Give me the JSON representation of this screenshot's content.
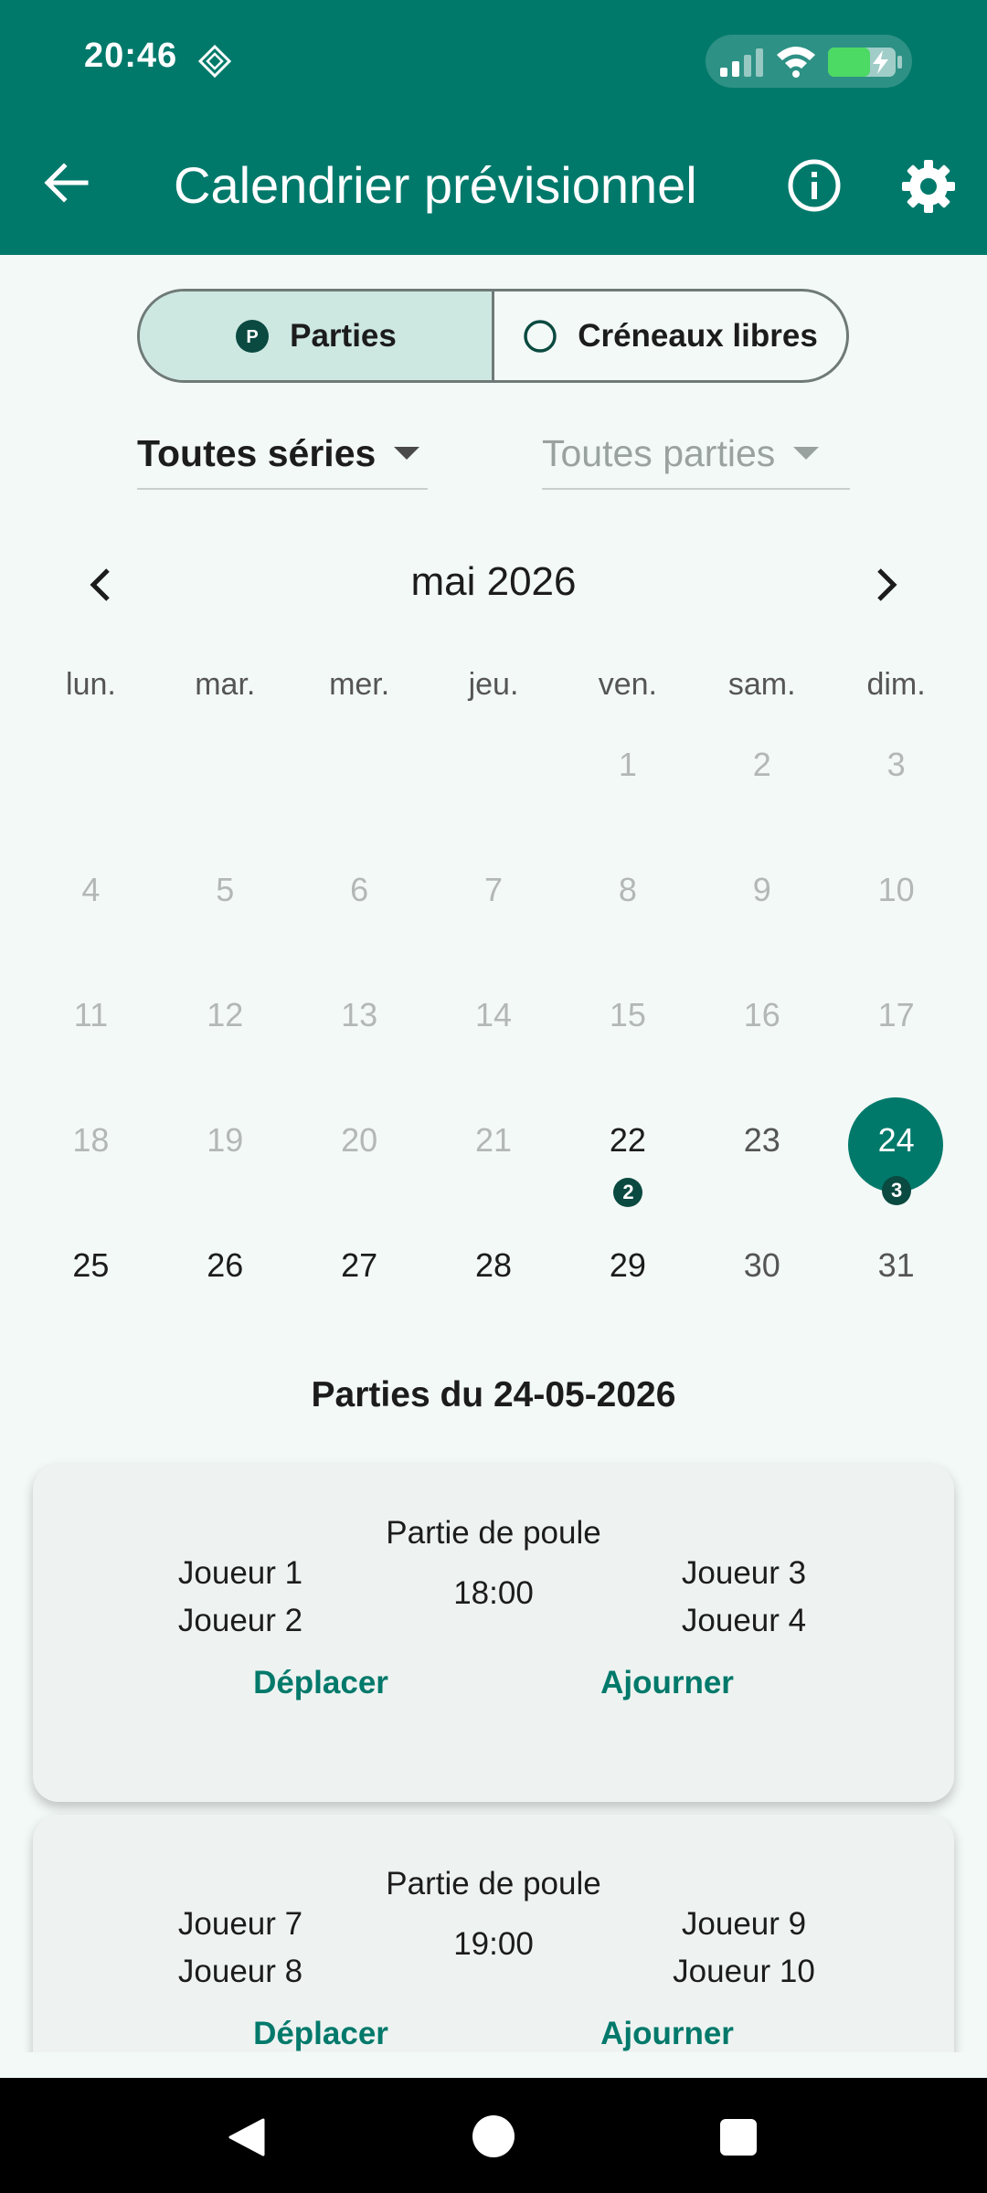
{
  "status_bar": {
    "time": "20:46"
  },
  "app_bar": {
    "title": "Calendrier prévisionnel"
  },
  "toggle": {
    "parties": "Parties",
    "creneaux": "Créneaux libres"
  },
  "filters": {
    "series": "Toutes séries",
    "parties": "Toutes parties"
  },
  "calendar": {
    "month": "mai 2026",
    "weekdays": [
      "lun.",
      "mar.",
      "mer.",
      "jeu.",
      "ven.",
      "sam.",
      "dim."
    ],
    "weeks": [
      [
        "",
        "",
        "",
        "",
        "1",
        "2",
        "3"
      ],
      [
        "4",
        "5",
        "6",
        "7",
        "8",
        "9",
        "10"
      ],
      [
        "11",
        "12",
        "13",
        "14",
        "15",
        "16",
        "17"
      ],
      [
        "18",
        "19",
        "20",
        "21",
        "22",
        "23",
        "24"
      ],
      [
        "25",
        "26",
        "27",
        "28",
        "29",
        "30",
        "31"
      ]
    ],
    "badges": {
      "22": "2",
      "24": "3"
    },
    "selected_day": "24"
  },
  "section": {
    "title": "Parties du 24-05-2026"
  },
  "matches": [
    {
      "title": "Partie de poule",
      "team_left": [
        "Joueur 1",
        "Joueur 2"
      ],
      "time": "18:00",
      "team_right": [
        "Joueur 3",
        "Joueur 4"
      ],
      "move": "Déplacer",
      "postpone": "Ajourner"
    },
    {
      "title": "Partie de poule",
      "team_left": [
        "Joueur 7",
        "Joueur 8"
      ],
      "time": "19:00",
      "team_right": [
        "Joueur 9",
        "Joueur 10"
      ],
      "move": "Déplacer",
      "postpone": "Ajourner"
    }
  ]
}
